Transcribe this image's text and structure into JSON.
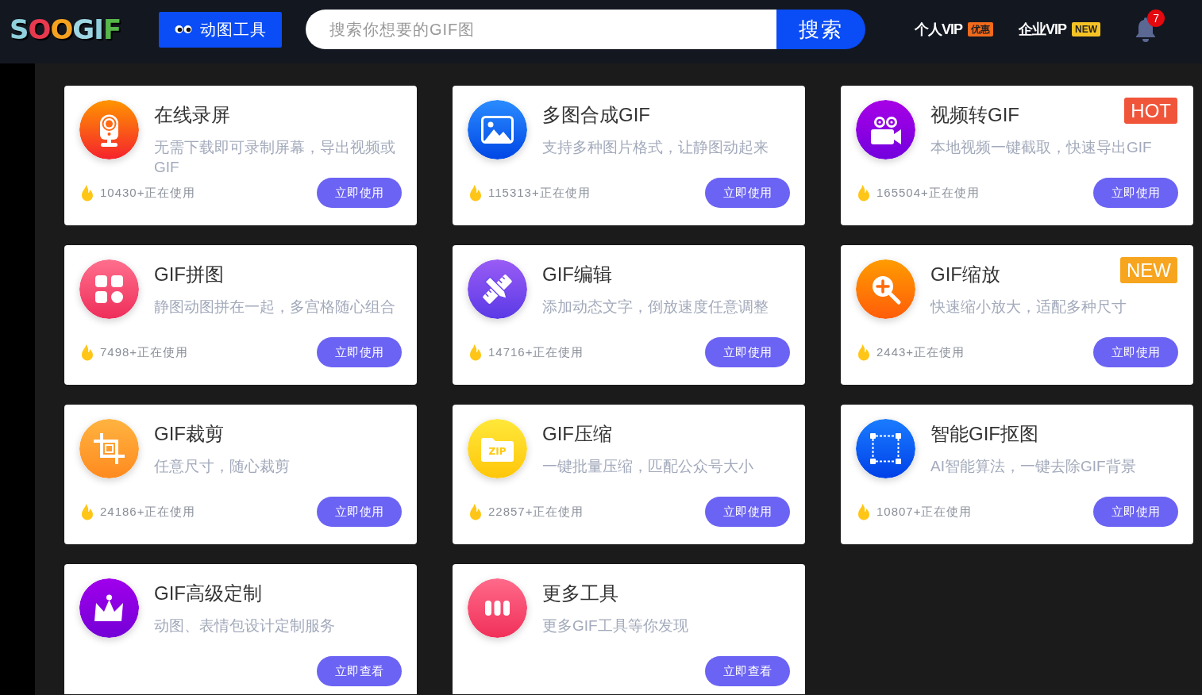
{
  "header": {
    "logo": "SOOGIF",
    "tools_button": "动图工具",
    "search": {
      "placeholder": "搜索你想要的GIF图",
      "button": "搜索"
    },
    "vip_links": [
      {
        "label": "个人VIP",
        "badge": {
          "text": "优惠",
          "color": "#f26a1b"
        }
      },
      {
        "label": "企业VIP",
        "badge": {
          "text": "NEW",
          "color": "#f6c324"
        }
      }
    ],
    "notifications": {
      "count": "7"
    }
  },
  "tools": [
    {
      "title": "在线录屏",
      "description": "无需下载即可录制屏幕，导出视频或GIF",
      "usage": "10430+正在使用",
      "button": "立即使用"
    },
    {
      "title": "多图合成GIF",
      "description": "支持多种图片格式，让静图动起来",
      "usage": "115313+正在使用",
      "button": "立即使用"
    },
    {
      "title": "视频转GIF",
      "description": "本地视频一键截取，快速导出GIF",
      "usage": "165504+正在使用",
      "button": "立即使用",
      "badge": {
        "text": "HOT",
        "color": "#f0553a"
      }
    },
    {
      "title": "GIF拼图",
      "description": "静图动图拼在一起，多宫格随心组合",
      "usage": "7498+正在使用",
      "button": "立即使用"
    },
    {
      "title": "GIF编辑",
      "description": "添加动态文字，倒放速度任意调整",
      "usage": "14716+正在使用",
      "button": "立即使用"
    },
    {
      "title": "GIF缩放",
      "description": "快速缩小放大，适配多种尺寸",
      "usage": "2443+正在使用",
      "button": "立即使用",
      "badge": {
        "text": "NEW",
        "color": "#f7a51e"
      }
    },
    {
      "title": "GIF裁剪",
      "description": "任意尺寸，随心裁剪",
      "usage": "24186+正在使用",
      "button": "立即使用"
    },
    {
      "title": "GIF压缩",
      "description": "一键批量压缩，匹配公众号大小",
      "usage": "22857+正在使用",
      "button": "立即使用",
      "icon_text": "ZIP"
    },
    {
      "title": "智能GIF抠图",
      "description": "AI智能算法，一键去除GIF背景",
      "usage": "10807+正在使用",
      "button": "立即使用"
    },
    {
      "title": "GIF高级定制",
      "description": "动图、表情包设计定制服务",
      "button": "立即查看"
    },
    {
      "title": "更多工具",
      "description": "更多GIF工具等你发现",
      "button": "立即查看"
    }
  ]
}
